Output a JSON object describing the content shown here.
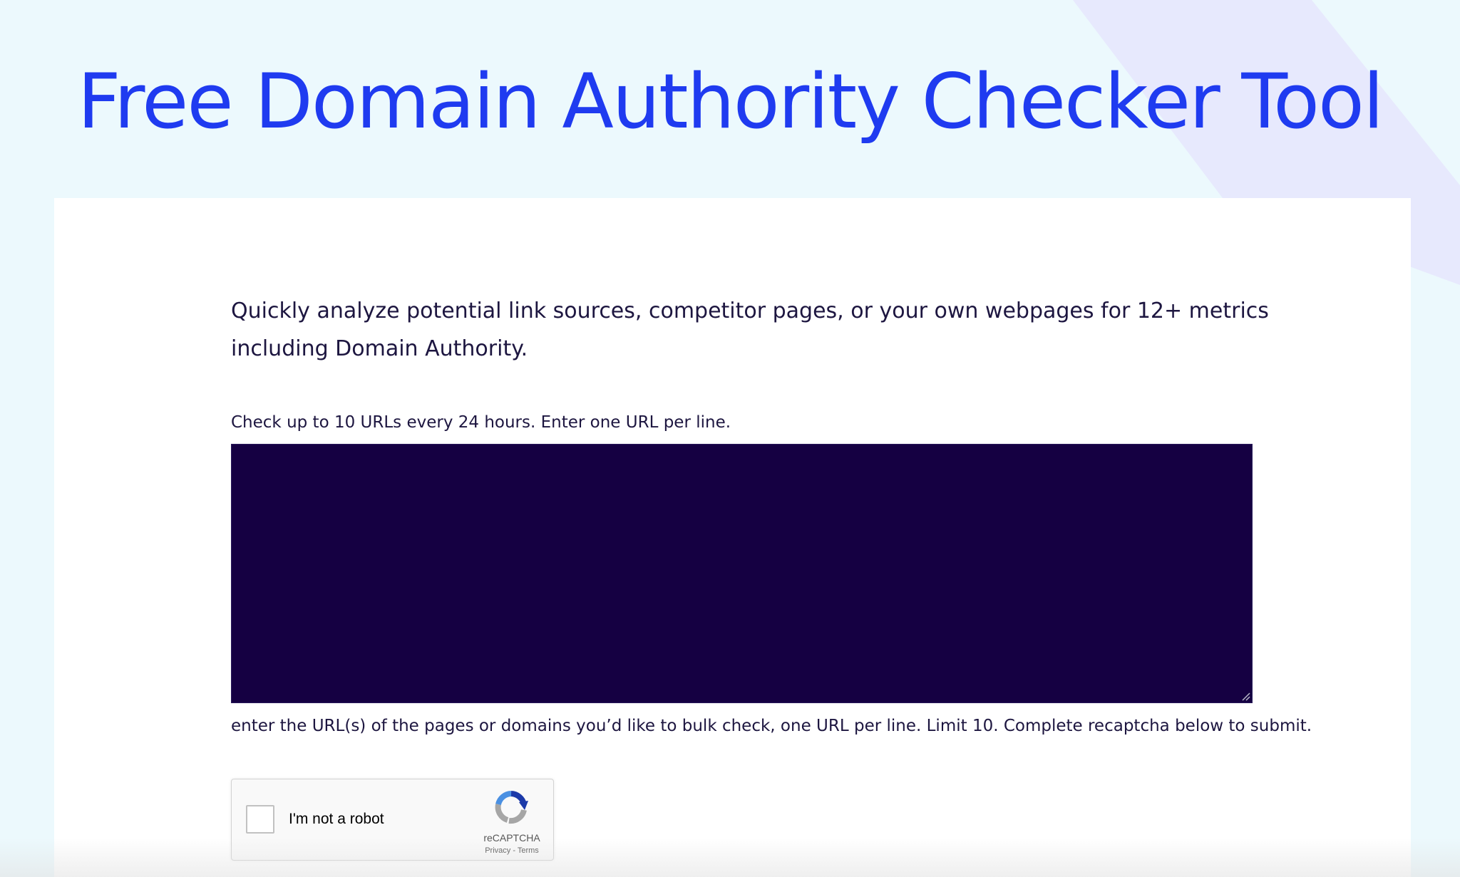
{
  "page": {
    "title": "Free Domain Authority Checker Tool"
  },
  "intro": {
    "text": "Quickly analyze potential link sources, competitor pages, or your own webpages for 12+ metrics including Domain Authority."
  },
  "url_form": {
    "label": "Check up to 10 URLs every 24 hours. Enter one URL per line.",
    "value": "",
    "helper": "enter the URL(s) of the pages or domains you’d like to bulk check, one URL per line. Limit 10. Complete recaptcha below to submit."
  },
  "recaptcha": {
    "label": "I'm not a robot",
    "brand": "reCAPTCHA",
    "privacy_link": "Privacy",
    "separator": " - ",
    "terms_link": "Terms",
    "checked": false
  },
  "colors": {
    "title": "#1f3bf0",
    "background": "#ecf9fd",
    "card": "#ffffff",
    "text": "#1d1640",
    "textarea_bg": "#150042",
    "stripe": "#e6e9fd"
  },
  "icons": {
    "recaptcha_logo": "recaptcha-logo-icon",
    "resize_grip": "resize-grip-icon"
  }
}
